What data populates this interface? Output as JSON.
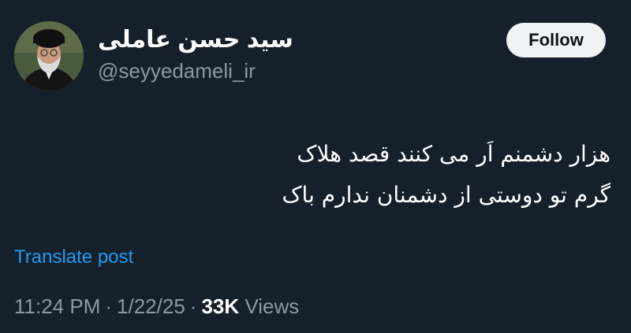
{
  "author": {
    "display_name": "سید حسن عاملی",
    "handle": "@seyyedameli_ir",
    "avatar_icon": "profile-photo"
  },
  "actions": {
    "follow_label": "Follow"
  },
  "tweet": {
    "lines": [
      "هزار دشمنم اَر می کنند قصد هلاک",
      "گرم تو دوستی از دشمنان ندارم باک"
    ],
    "translate_label": "Translate post",
    "time": "11:24 PM",
    "separator": "·",
    "date": "1/22/25",
    "views_count": "33K",
    "views_label": "Views"
  },
  "colors": {
    "background": "#15202b",
    "link": "#1d9bf0",
    "secondary_text": "#8b98a5",
    "button_bg": "#eff3f4"
  }
}
